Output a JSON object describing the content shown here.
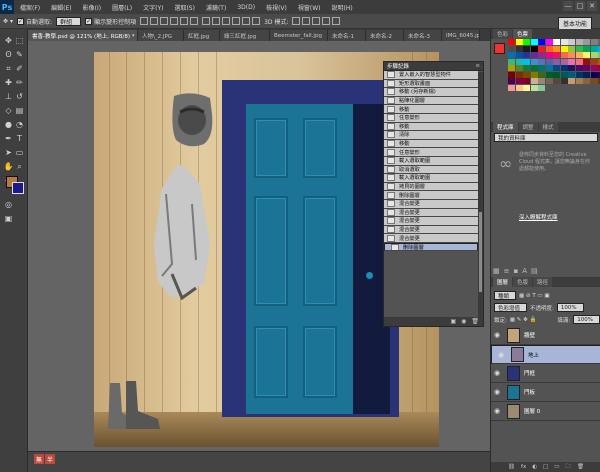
{
  "menubar": {
    "logo": "Ps",
    "items": [
      "檔案(F)",
      "編輯(E)",
      "影像(I)",
      "圖層(L)",
      "文字(Y)",
      "選取(S)",
      "濾鏡(T)",
      "3D(D)",
      "檢視(V)",
      "視窗(W)",
      "說明(H)"
    ],
    "window_controls": [
      "—",
      "□",
      "✕"
    ]
  },
  "options": {
    "auto_select_label": "自動選取:",
    "auto_select_value": "群組",
    "show_transform_label": "顯示變形控制項",
    "mode_3d": "3D 模式:",
    "workspace": "基本功能"
  },
  "tabs": [
    {
      "label": "書香-教學.psd @ 121% (地上, RGB/8) *",
      "active": true
    },
    {
      "label": "人物\\_2.JPG",
      "active": false
    },
    {
      "label": "紅框.jpg",
      "active": false
    },
    {
      "label": "綠三紅框.jpg",
      "active": false
    },
    {
      "label": "Beemster_fall.jpg",
      "active": false
    },
    {
      "label": "未命名-1",
      "active": false
    },
    {
      "label": "未命名-2",
      "active": false
    },
    {
      "label": "未命名-3",
      "active": false
    },
    {
      "label": "IMG_6045.jp",
      "active": false
    }
  ],
  "history": {
    "title": "步驟記錄",
    "items": [
      "置入嵌入的智慧型物件",
      "矩形選取畫面",
      "移動 (另存新檔)",
      "點陣化圖層",
      "移動",
      "任意變形",
      "移動",
      "清除",
      "移動",
      "任意變形",
      "載入選取範圍",
      "取消選取",
      "載入選取範圍",
      "拷貝的圖層",
      "刪除圖層",
      "混合變更",
      "混合變更",
      "混合變更",
      "混合變更",
      "混合變更",
      "刪除圖層"
    ],
    "selected_index": 20
  },
  "swatches_panel": {
    "tabs": [
      {
        "label": "色彩",
        "active": false
      },
      {
        "label": "色票",
        "active": true
      }
    ],
    "colors": [
      "#ff0000",
      "#ffff00",
      "#00ff00",
      "#00ffff",
      "#0000ff",
      "#ff00ff",
      "#ffffff",
      "#e5e5e5",
      "#cccccc",
      "#b3b3b3",
      "#999999",
      "#808080",
      "#666666",
      "#4d4d4d",
      "#333333",
      "#1a1a1a",
      "#000000",
      "#ee1d24",
      "#f26522",
      "#f7941d",
      "#fff200",
      "#8dc63f",
      "#39b54a",
      "#00a651",
      "#00a99d",
      "#00aeef",
      "#0072bc",
      "#0054a6",
      "#2e3192",
      "#662d91",
      "#92278f",
      "#ec008c",
      "#ed145b",
      "#f26c4f",
      "#f68e56",
      "#fbaf5d",
      "#fff568",
      "#acd373",
      "#7cc576",
      "#3cb878",
      "#1abbb4",
      "#00bff3",
      "#448ccb",
      "#5674b9",
      "#605ca8",
      "#8560a8",
      "#a864a8",
      "#f06eaa",
      "#f26d7d",
      "#9e0b0f",
      "#a0410d",
      "#a36209",
      "#aba000",
      "#598527",
      "#197b30",
      "#007236",
      "#00746b",
      "#0076a3",
      "#004a80",
      "#003471",
      "#1b1464",
      "#440e62",
      "#630460",
      "#9e005d",
      "#9e0039",
      "#790000",
      "#7b2e00",
      "#7d4900",
      "#827b00",
      "#406618",
      "#005e20",
      "#005826",
      "#005952",
      "#005b7f",
      "#003663",
      "#002157",
      "#0d004c",
      "#32004b",
      "#4b0049",
      "#7b0046",
      "#7a0026",
      "#c7b299",
      "#998675",
      "#736357",
      "#534741",
      "#37302a",
      "#c69c6d",
      "#a67c52",
      "#8c6239",
      "#754c24",
      "#603913",
      "#f5989d",
      "#fdc68a",
      "#fff799",
      "#c4df9b",
      "#82ca9c"
    ]
  },
  "library_panel": {
    "tabs": [
      {
        "label": "程式庫",
        "active": true
      },
      {
        "label": "調整",
        "active": false
      },
      {
        "label": "樣式",
        "active": false
      }
    ],
    "library_select": "我的資料庫",
    "cc_text": "發佈同步資料至您的 Creative Cloud 程式庫，讓您無論身在何處都能使用。",
    "cc_link": "深入瞭解程式庫"
  },
  "layers_panel": {
    "tabs": [
      {
        "label": "圖層",
        "active": true
      },
      {
        "label": "色版",
        "active": false
      },
      {
        "label": "路徑",
        "active": false
      }
    ],
    "kind_filter": "種類",
    "blend_mode": "色彩增值",
    "opacity_label": "不透明度:",
    "opacity": "100%",
    "lock_label": "鎖定:",
    "fill_label": "填滿:",
    "fill": "100%",
    "layers": [
      {
        "name": "牆壁",
        "thumb": "#c4a37a",
        "selected": false
      },
      {
        "name": "地上",
        "thumb": "#8a7a9c",
        "selected": true
      },
      {
        "name": "門框",
        "thumb": "#2a3377",
        "selected": false
      },
      {
        "name": "門板",
        "thumb": "#1b7396",
        "selected": false
      },
      {
        "name": "圖層 0",
        "thumb": "#9a8a70",
        "selected": false
      }
    ],
    "footer_icons": [
      "fx",
      "◐",
      "□",
      "▭",
      "🗀",
      "🗑"
    ]
  },
  "status": {
    "buttons": [
      "無",
      "半"
    ]
  },
  "foreground_color": "#b77a3e",
  "background_color": "#1a1a8c"
}
